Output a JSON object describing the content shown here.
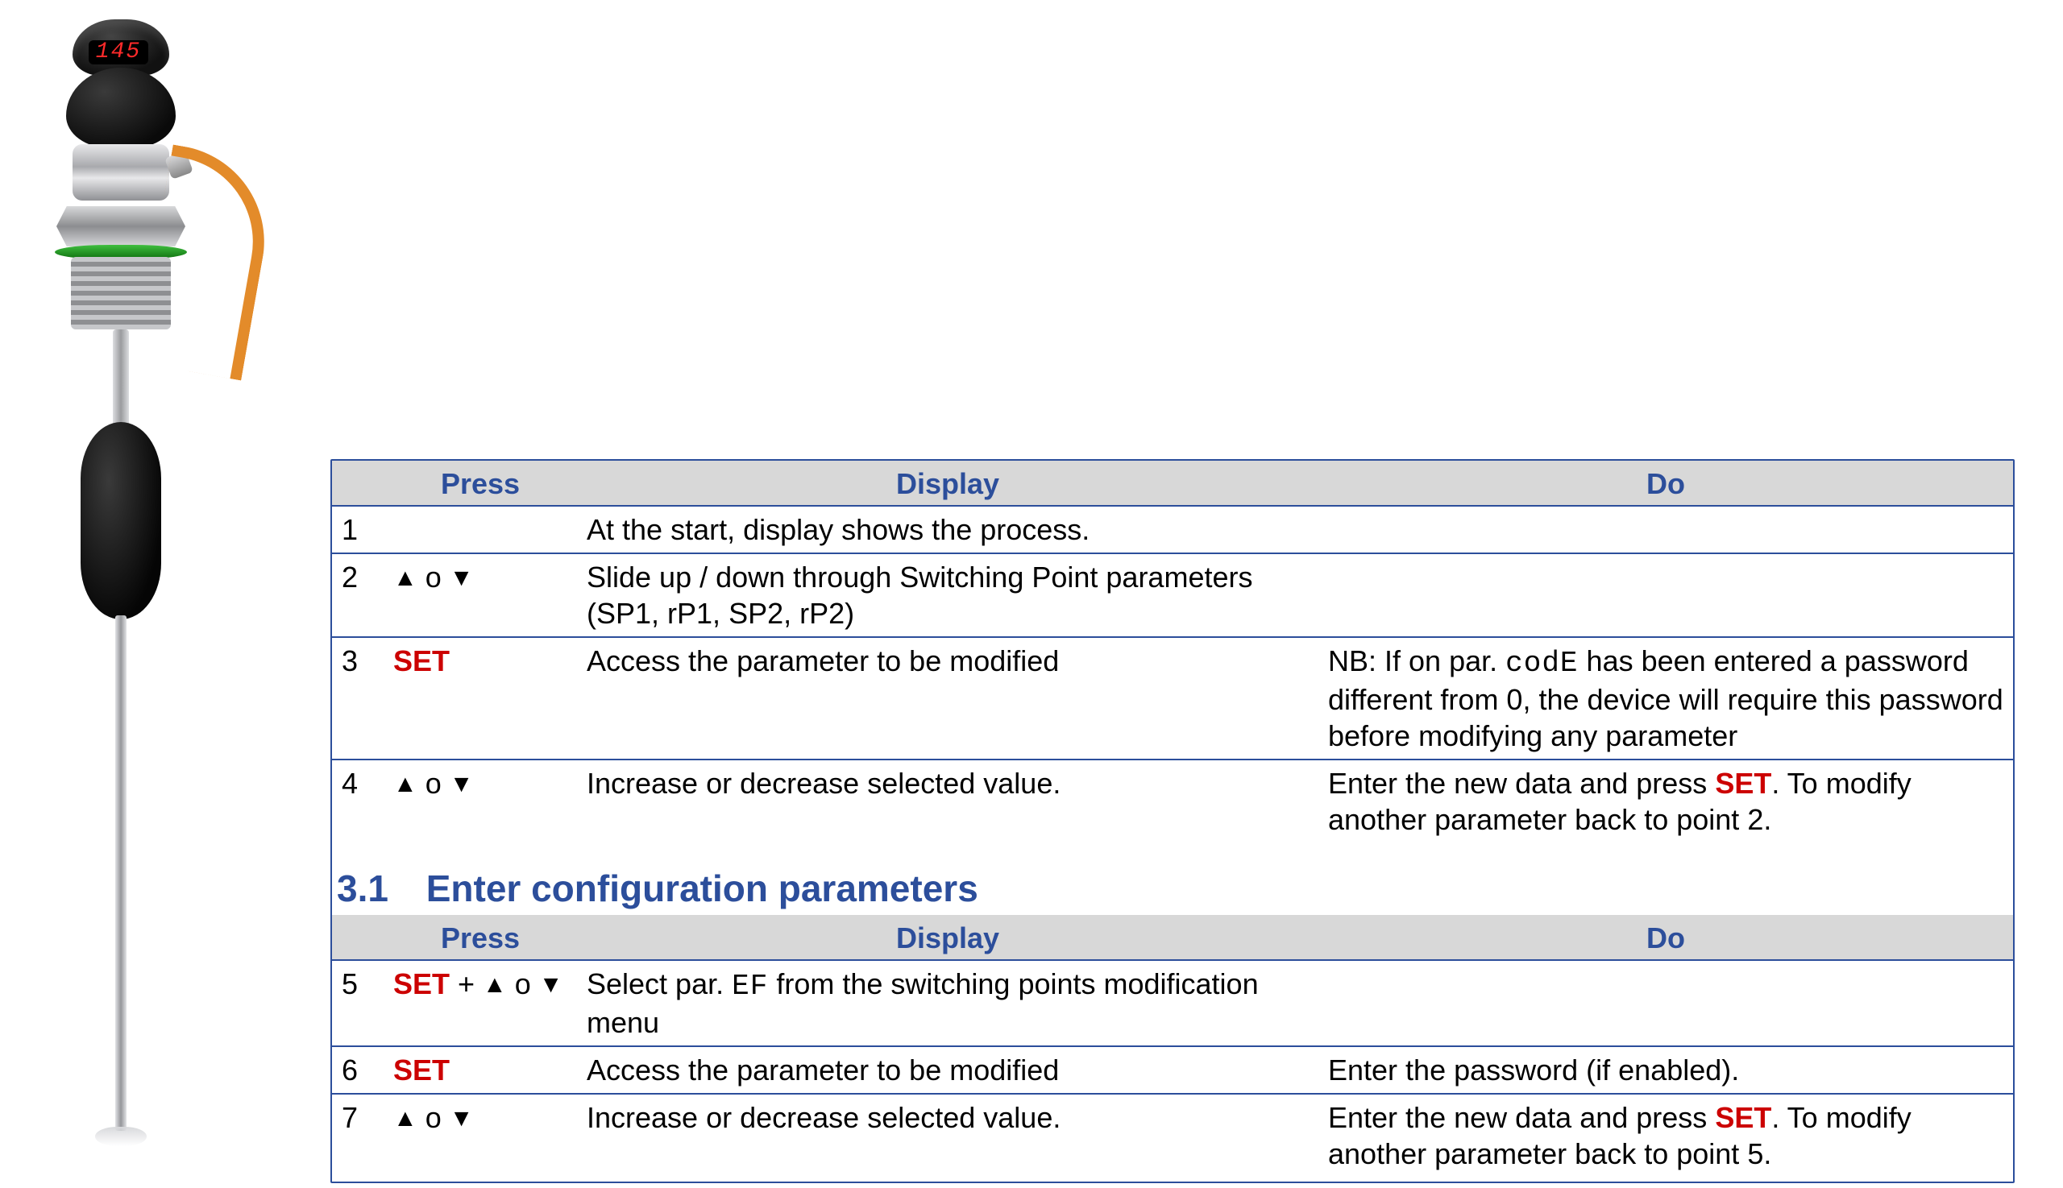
{
  "device": {
    "display_value": "145"
  },
  "table1": {
    "headers": {
      "press": "Press",
      "display": "Display",
      "do_": "Do"
    },
    "rows": [
      {
        "n": "1",
        "press_html": "",
        "display": "At the start, display shows the process.",
        "do_": ""
      },
      {
        "n": "2",
        "press_html": "▲ o ▼",
        "display": "Slide up / down through Switching Point parameters (SP1, rP1, SP2, rP2)",
        "do_": ""
      },
      {
        "n": "3",
        "press_html": "<span class='set'>SET</span>",
        "display": "Access the parameter to be modified",
        "do_": "NB: If on par. <span class='mono'>codE</span> has been entered a password different from 0, the device will require this password before modifying any parameter"
      },
      {
        "n": "4",
        "press_html": "▲ o ▼",
        "display": "Increase or decrease selected value.",
        "do_": "Enter the new data and press <span class='set'>SET</span>. To modify another parameter back to point 2."
      }
    ]
  },
  "section": {
    "number": "3.1",
    "title": "Enter configuration parameters"
  },
  "table2": {
    "headers": {
      "press": "Press",
      "display": "Display",
      "do_": "Do"
    },
    "rows": [
      {
        "n": "5",
        "press_html": "<span class='set'>SET</span> + ▲ o ▼",
        "display": "Select par. <span class='mono'>EF</span> from the switching points modification menu",
        "do_": ""
      },
      {
        "n": "6",
        "press_html": "<span class='set'>SET</span>",
        "display": "Access the parameter to be modified",
        "do_": "Enter the password (if enabled)."
      },
      {
        "n": "7",
        "press_html": "▲ o ▼",
        "display": "Increase or decrease selected value.",
        "do_": "Enter the new data and press <span class='set'>SET</span>. To modify another parameter back to point 5."
      }
    ]
  }
}
